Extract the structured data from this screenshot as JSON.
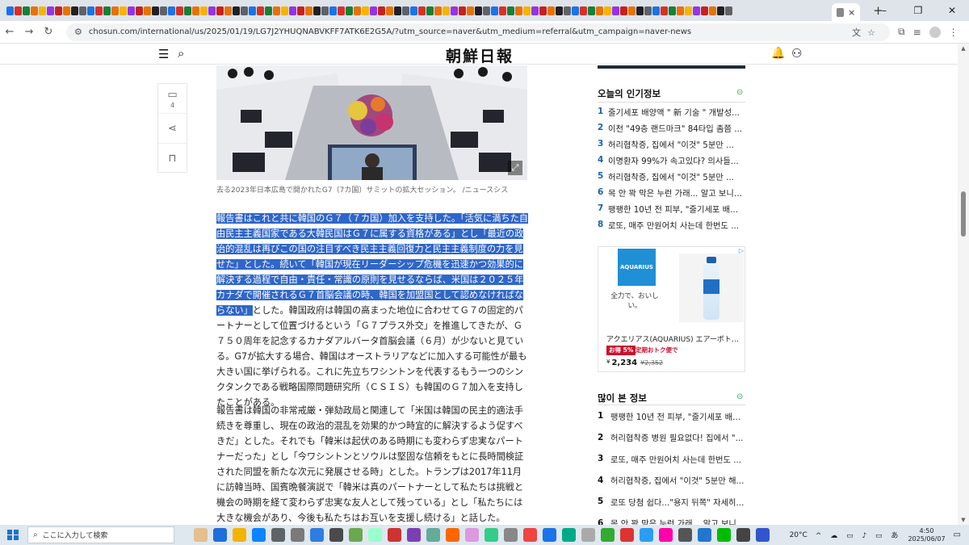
{
  "browser": {
    "url": "chosun.com/international/us/2025/01/19/LG7J2YHUQNABVKFF7ATK6E2G5A/?utm_source=naver&utm_medium=referral&utm_campaign=naver-news",
    "new_tab_label": "+",
    "close_tab_label": "×",
    "window_controls": [
      "–",
      "❐",
      "✕"
    ]
  },
  "site": {
    "logo": "朝鮮日報"
  },
  "share_rail": {
    "comment_count": "4"
  },
  "article": {
    "caption": "去る2023年日本広島で開かれたG7（7カ国）サミットの拡大セッション。 /ニュースシス",
    "para1_highlighted": "報告書はこれと共に韓国のＧ７（７カ国）加入を支持した。「活気に満ちた自由民主主義国家である大韓民国はＧ７に属する資格がある」とし「最近の政治的混乱は再びこの国の注目すべき民主主義回復力と民主主義制度の力を見せた」とした。続いて「韓国が現在リーダーシップ危機を迅速かつ効果的に解決する過程で自由・責任・常識の原則を見せるならば、米国は２０２５年カナダで開催されるＧ７首脳会議の時、韓国を加盟国として認めなければならない」",
    "para1_rest": "とした。韓国政府は韓国の高まった地位に合わせてＧ７の固定的パートナーとして位置づけるという「Ｇ７プラス外交」を推進してきたが、Ｇ７５０周年を記念するカナダアルバータ首脳会議（６月）が少ないと見ている。G7が拡大する場合、韓国はオーストラリアなどに加入する可能性が最も大きい国に挙げられる。これに先立ちワシントンを代表するもう一つのシンクタンクである戦略国際問題研究所（ＣＳＩＳ）も韓国のＧ７加入を支持したことがある。",
    "para2": "報告書は韓国の非常戒厳・弾劾政局と関連して「米国は韓国の民主的適法手続きを尊重し、現在の政治的混乱を効果的かつ時宜的に解決するよう促すべきだ」とした。それでも「韓米は起伏のある時期にも変わらず忠実なパートナーだった」とし「今ワシントンとソウルは堅固な信頼をもとに長時間検証された同盟を新たな次元に発展させる時」とした。トランプは2017年11月に訪韓当時、国賓晩餐演説で「韓米は真のパートナーとして私たちは挑戦と機会の時期を経て変わらず忠実な友人として残っている」とし「私たちには大きな機会があり、今後も私たちはお互いを支援し続ける」と話した。"
  },
  "sidebar": {
    "today_title": "오늘의 인기정보",
    "today_items": [
      {
        "num": "1",
        "text": "줄기세포 배양액 \" 新 기술 \" 개발성..."
      },
      {
        "num": "2",
        "text": "이천 \"49층 랜드마크\" 84타입 좀쯤 ..."
      },
      {
        "num": "3",
        "text": "허리협착증, 집에서 \"이것\" 5분만 ..."
      },
      {
        "num": "4",
        "text": "이명환자 99%가 속고있다? 의사들..."
      },
      {
        "num": "5",
        "text": "허리협착증, 집에서 \"이것\" 5분만 ..."
      },
      {
        "num": "6",
        "text": "목 안 꽉 막은 누런 가래... 알고 보니 ..."
      },
      {
        "num": "7",
        "text": "팽팽한 10년 전 피부, \"줄기세포 배..."
      },
      {
        "num": "8",
        "text": "로또, 매주 만원어치 사는데 한번도 ..."
      }
    ],
    "ad": {
      "logo_text": "AQUARIUS",
      "tagline": "全力で、おいしい。",
      "product_name": "アクエリアス(AQUARIUS) エアーボトル...",
      "badge": "お得 5%",
      "badge_note": "定期おトク便で",
      "price": "2,234",
      "old_price": "¥2,352",
      "yen": "¥"
    },
    "popular_title": "많이 본 정보",
    "popular_items": [
      {
        "num": "1",
        "text": "팽팽한 10년 전 피부, \"줄기세포 배..."
      },
      {
        "num": "2",
        "text": "허리협착증 병원 필요없다! 집에서 \"..."
      },
      {
        "num": "3",
        "text": "로또, 매주 만원어치 사는데 한번도 ..."
      },
      {
        "num": "4",
        "text": "허리협착증, 집에서 \"이것\" 5분만 해..."
      },
      {
        "num": "5",
        "text": "로또 당첨 쉽다...\"용지 뒤쪽\" 자세히..."
      },
      {
        "num": "6",
        "text": "목 안 꽉 막은 누런 가래... 알고 보니 ..."
      }
    ]
  },
  "taskbar": {
    "search_placeholder": "ここに入力して検索",
    "weather": "20°C",
    "time": "4:50",
    "date": "2025/06/07",
    "tray_icons": "^ ☁ ▭ ♪ ▭ あ"
  },
  "colors": {
    "highlight": "#2f66c9",
    "rank_blue": "#1b5fb3",
    "link_green": "#3aa05c"
  }
}
